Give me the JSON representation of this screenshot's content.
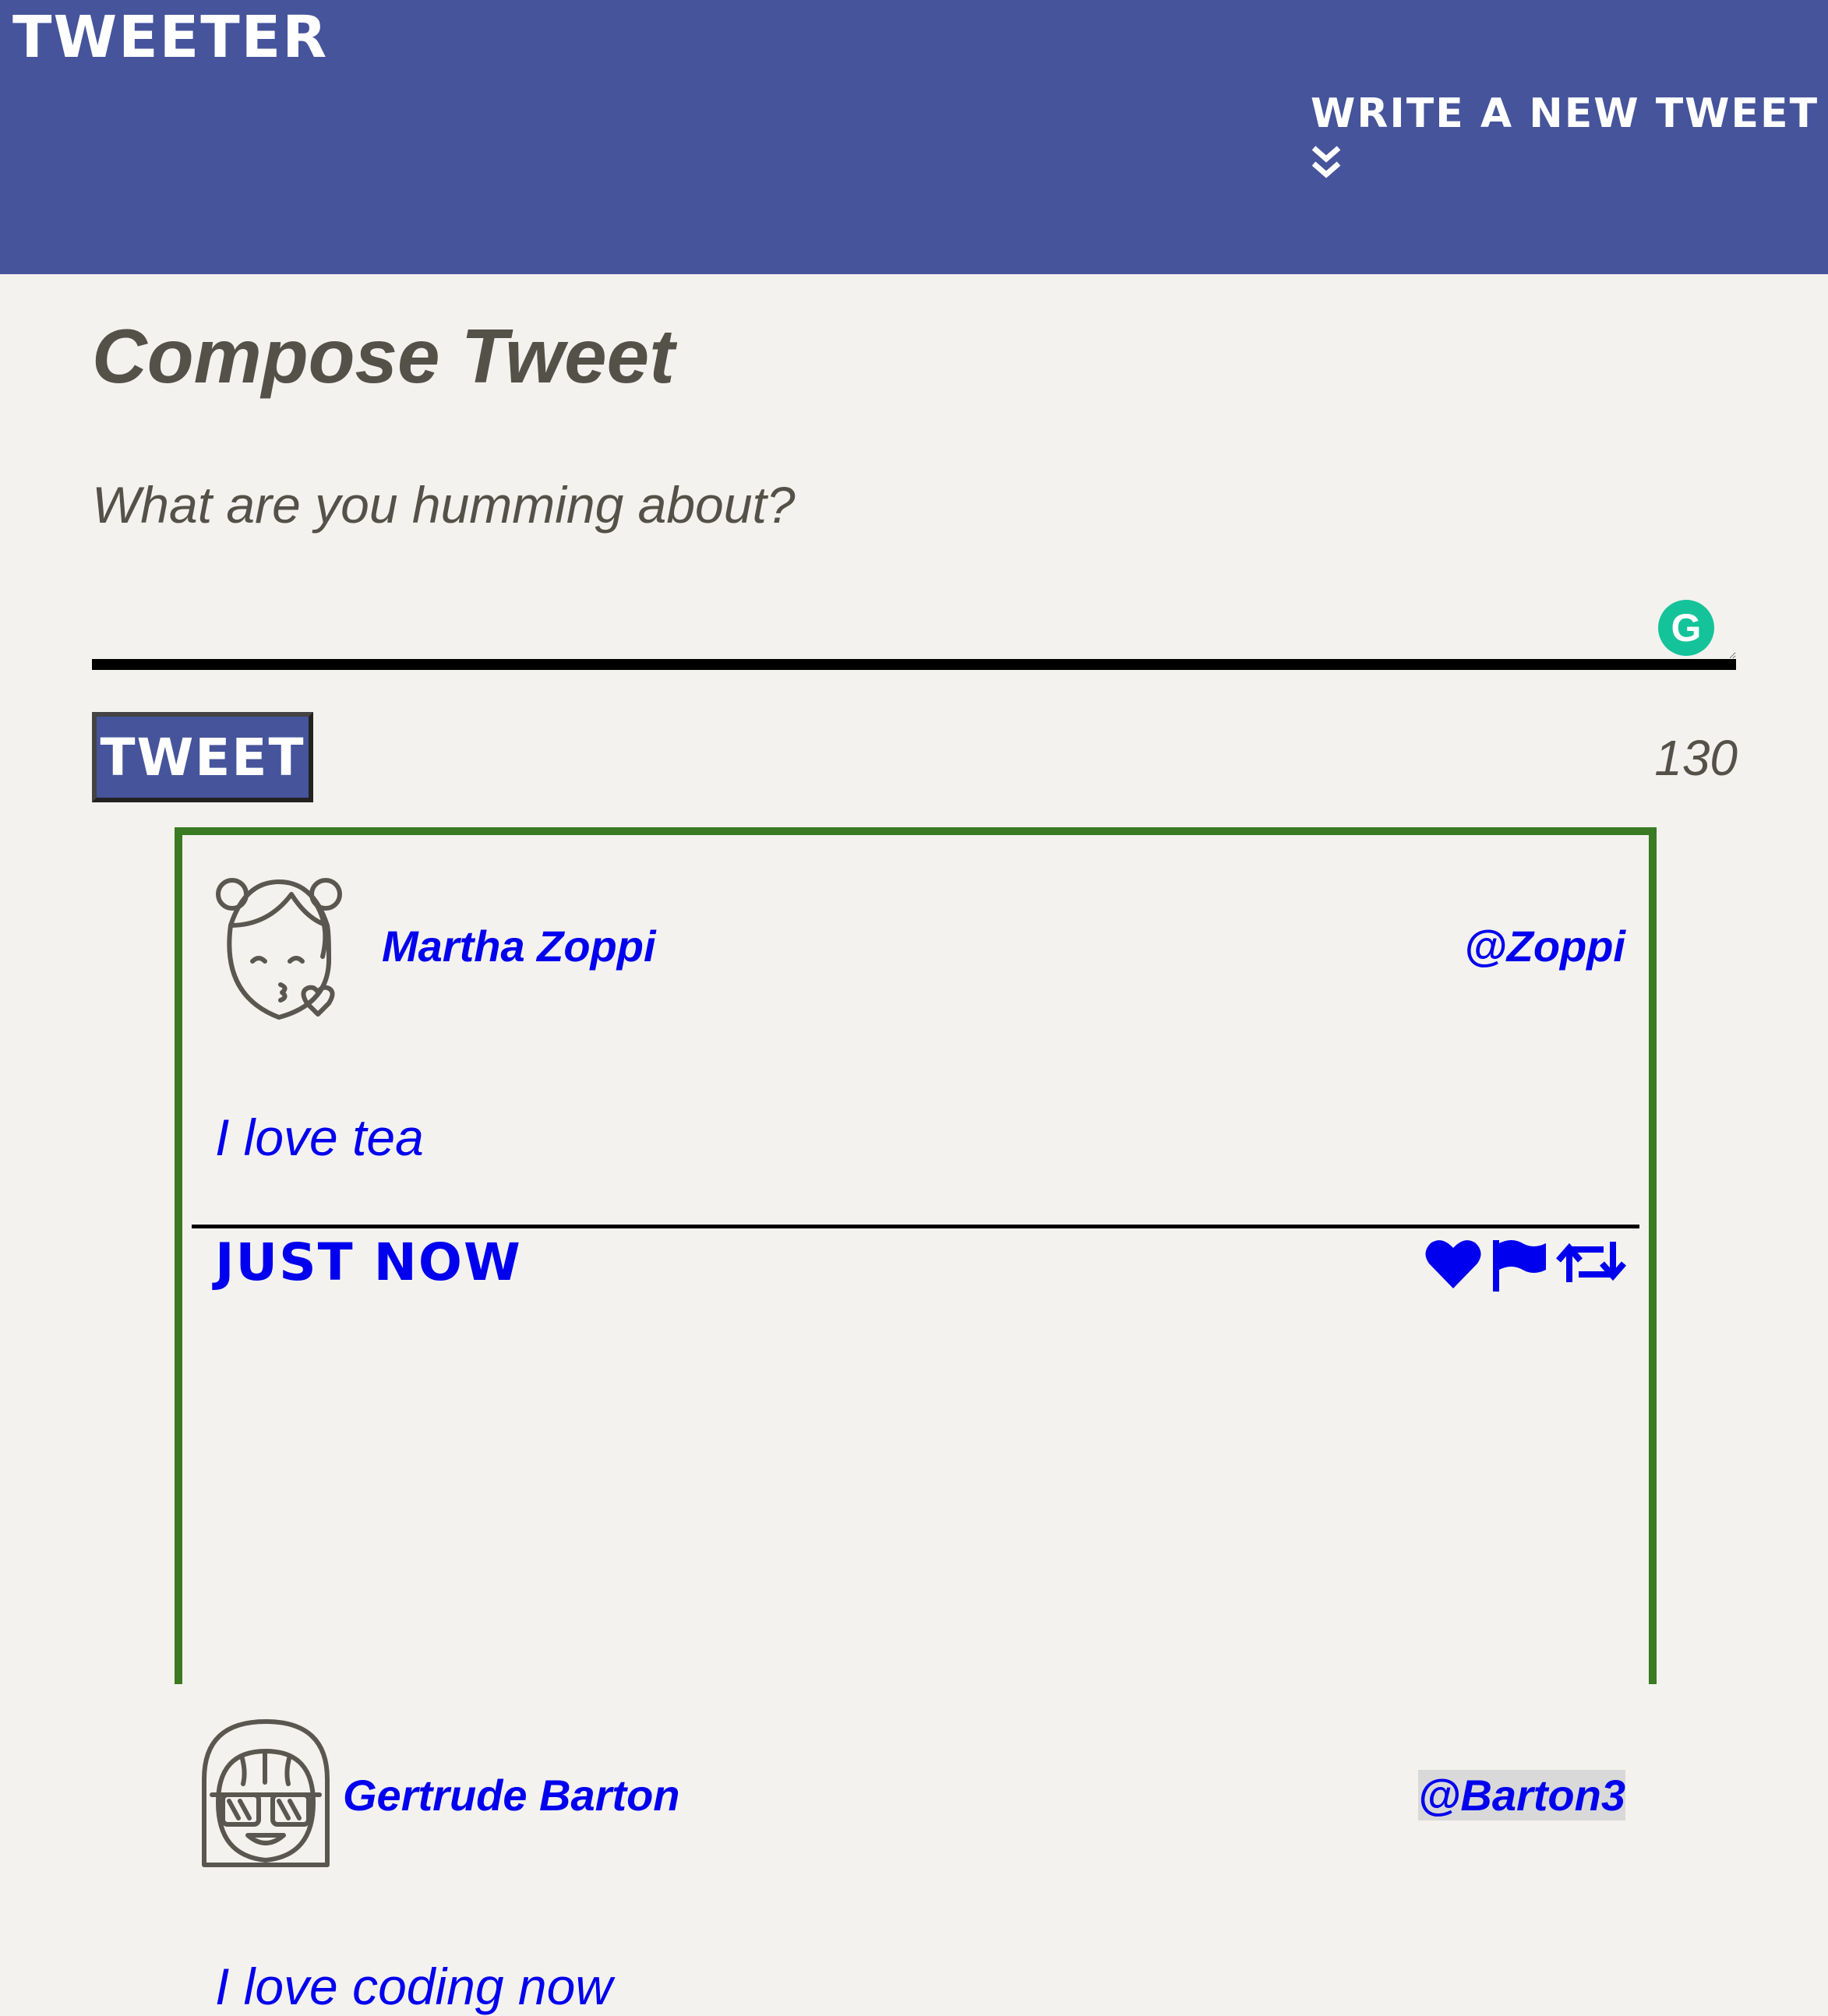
{
  "nav": {
    "brand": "TWEETER",
    "compose_toggle": "WRITE A NEW TWEET",
    "chevron_icon": "double-chevron-down-icon"
  },
  "compose": {
    "title": "Compose Tweet",
    "placeholder": "What are you humming about?",
    "button_label": "TWEET",
    "counter": "130",
    "grammarly_icon": "G"
  },
  "colors": {
    "nav_bg": "#46549b",
    "page_bg": "#f4f2ee",
    "tweet_border": "#3a7a22",
    "link": "#0000ee"
  },
  "tweets": [
    {
      "name": "Martha Zoppi",
      "handle": "@Zoppi",
      "text": "I love tea",
      "time": "JUST NOW",
      "avatar_icon": "kissing-face-avatar-icon",
      "actions": [
        "heart-icon",
        "flag-icon",
        "retweet-icon"
      ]
    },
    {
      "name": "Gertrude Barton",
      "handle": "@Barton3",
      "text": "I love coding now",
      "avatar_icon": "sunglasses-girl-avatar-icon"
    }
  ]
}
